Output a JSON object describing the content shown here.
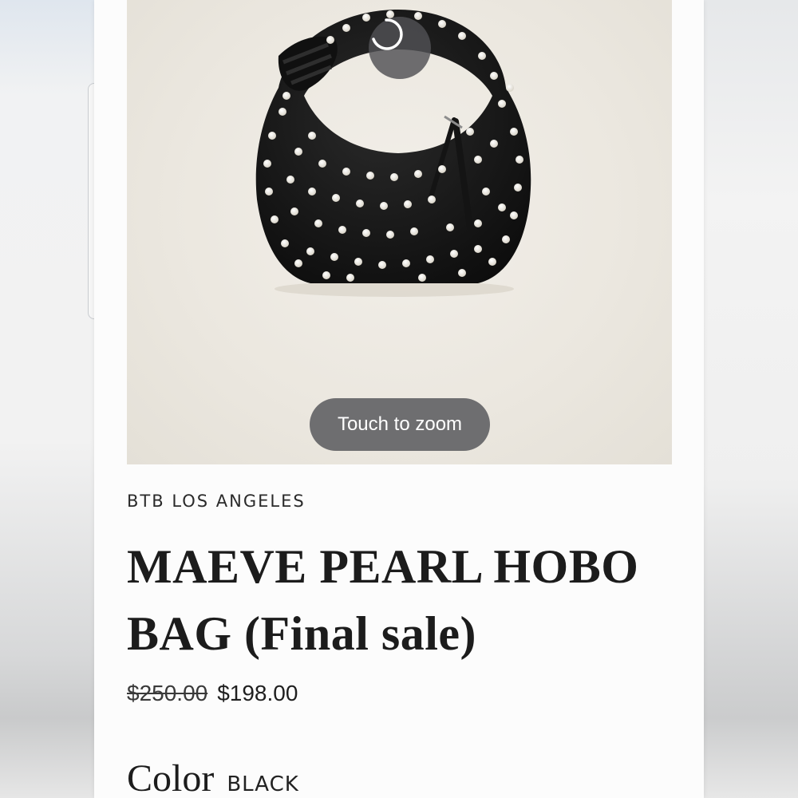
{
  "product": {
    "image_alt_icon": "black-pearl-hobo-bag",
    "loading_icon": "loading-spinner-icon",
    "zoom_hint": "Touch to zoom",
    "brand": "BTB LOS ANGELES",
    "title": "MAEVE PEARL HOBO BAG (Final sale)",
    "price": {
      "original": "$250.00",
      "sale": "$198.00"
    },
    "color": {
      "label": "Color",
      "value": "BLACK"
    }
  },
  "colors": {
    "page_bg": "#fcfcfc",
    "text": "#1c1c1c",
    "pill_bg": "#606064",
    "bag": "#151515",
    "pearl": "#f4f1ea"
  }
}
